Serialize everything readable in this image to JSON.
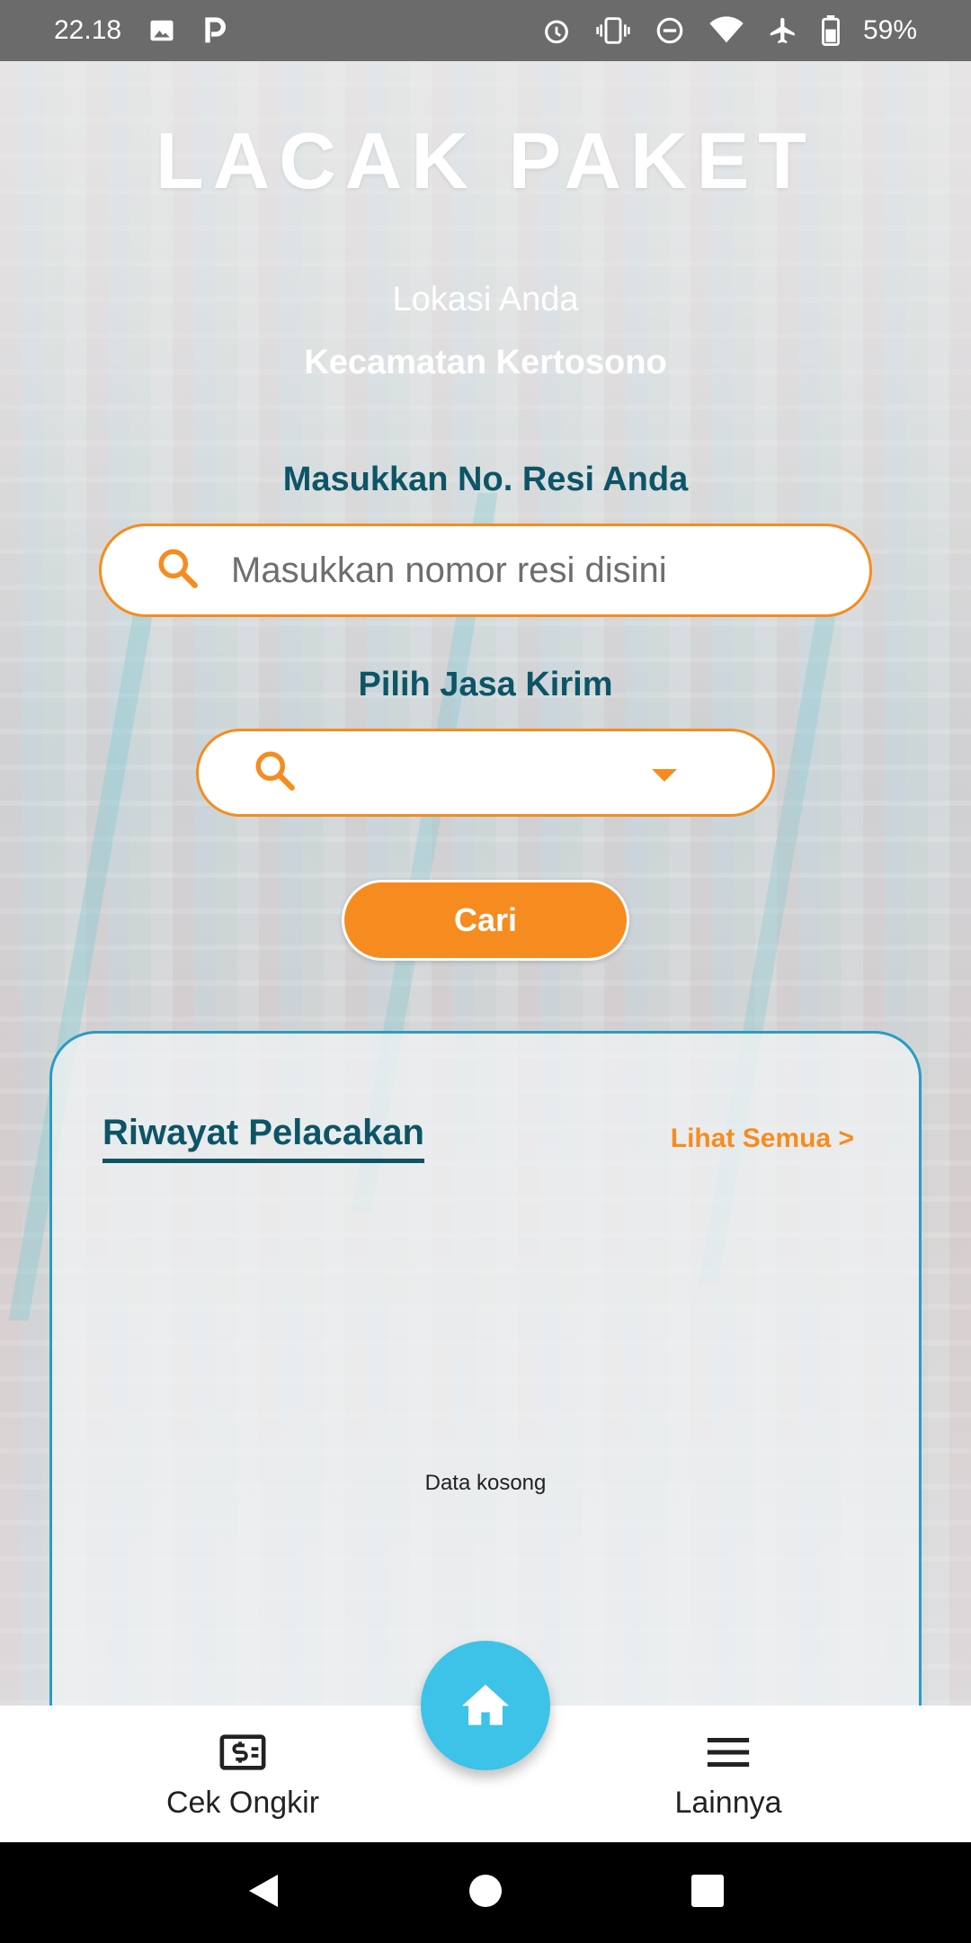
{
  "status_bar": {
    "time": "22.18",
    "battery": "59%",
    "icons": [
      "image-icon",
      "parking-icon",
      "alarm-icon",
      "vibrate-icon",
      "dnd-icon",
      "wifi-icon",
      "airplane-icon",
      "battery-icon"
    ]
  },
  "header": {
    "title": "LACAK PAKET",
    "location_label": "Lokasi Anda",
    "location_value": "Kecamatan Kertosono"
  },
  "search": {
    "resi_label": "Masukkan No. Resi Anda",
    "resi_placeholder": "Masukkan nomor resi disini",
    "resi_value": "",
    "courier_label": "Pilih Jasa Kirim",
    "courier_value": "",
    "button_label": "Cari"
  },
  "history": {
    "title": "Riwayat Pelacakan",
    "see_all": "Lihat Semua >",
    "empty_text": "Data kosong"
  },
  "bottom_nav": {
    "left_label": "Cek Ongkir",
    "right_label": "Lainnya",
    "center_icon": "home-icon"
  },
  "colors": {
    "accent": "#f68c1f",
    "heading": "#0d5566",
    "fab": "#3cc3e7",
    "card_border": "#2a9bc7"
  }
}
